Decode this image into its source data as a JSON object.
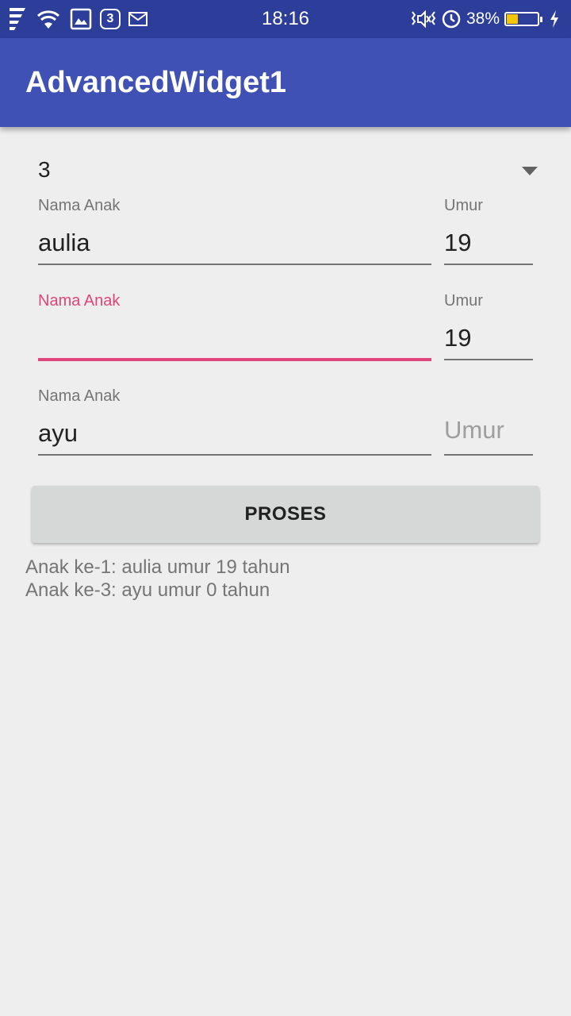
{
  "status_bar": {
    "time": "18:16",
    "notification_count": "3",
    "battery_percent": "38%",
    "battery_level": 0.38,
    "icons": [
      "app-logo-icon",
      "wifi-icon",
      "image-icon",
      "mail-icon",
      "vibrate-icon",
      "alarm-clock-icon",
      "charging-icon"
    ]
  },
  "app_bar": {
    "title": "AdvancedWidget1",
    "color": "#3f51b5"
  },
  "spinner": {
    "selected": "3"
  },
  "rows": [
    {
      "name_label": "Nama Anak",
      "name_value": "aulia",
      "age_label": "Umur",
      "age_value": "19"
    },
    {
      "name_label": "Nama Anak",
      "name_value": "",
      "age_label": "Umur",
      "age_value": "19"
    },
    {
      "name_label": "Nama Anak",
      "name_value": "ayu",
      "age_placeholder": "Umur",
      "age_value": ""
    }
  ],
  "focus_color": "#e0457b",
  "button": {
    "label": "PROSES"
  },
  "results": [
    "Anak ke-1: aulia umur 19 tahun",
    "Anak ke-3: ayu umur 0 tahun"
  ]
}
